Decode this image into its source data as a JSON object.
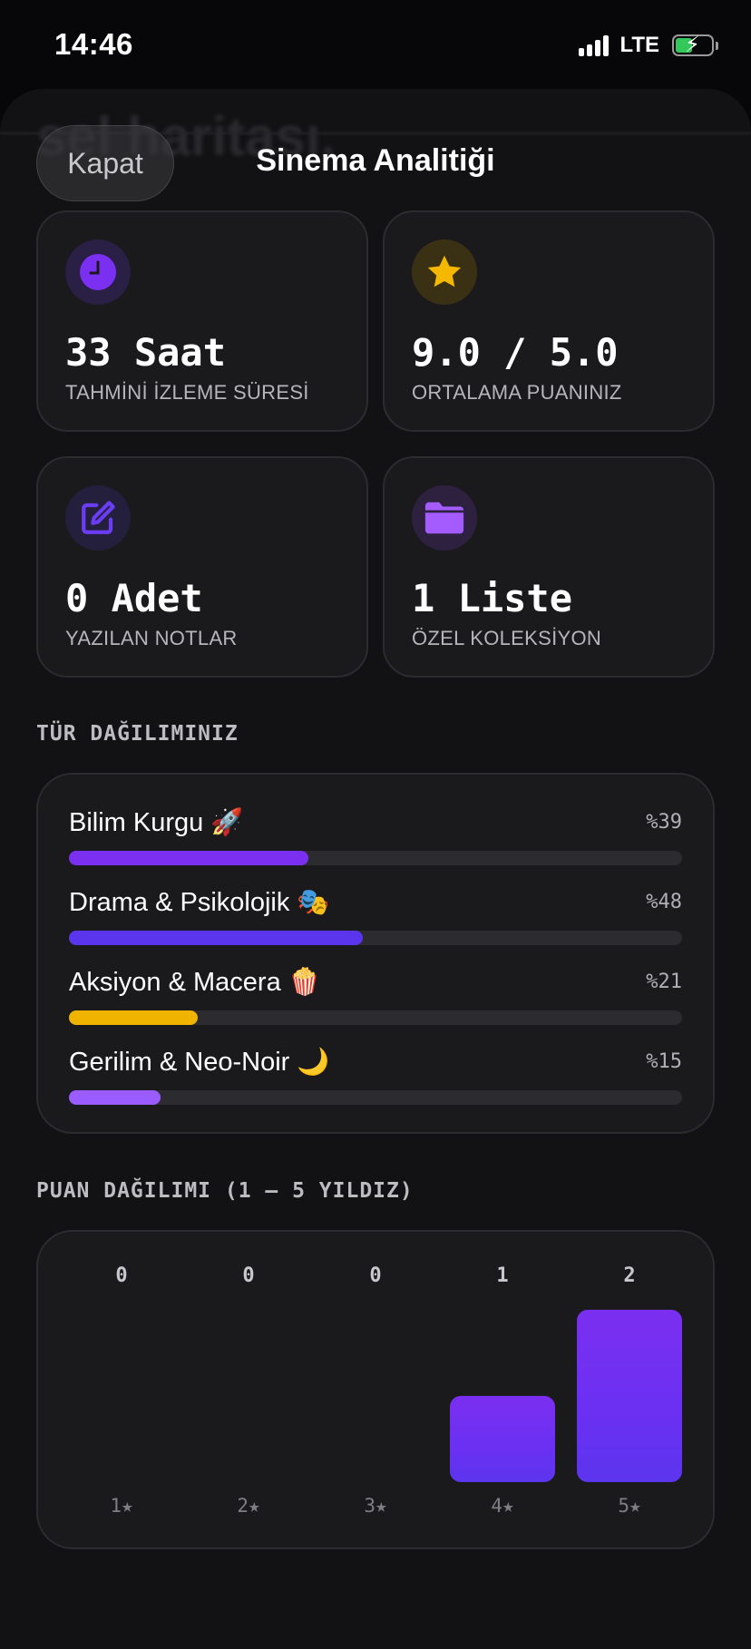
{
  "status_bar": {
    "time": "14:46",
    "network": "LTE"
  },
  "background_title": "sel haritası.",
  "header": {
    "close_label": "Kapat",
    "title": "Sinema Analitiği"
  },
  "stats": [
    {
      "value": "33 Saat",
      "label": "TAHMİNİ İZLEME SÜRESİ",
      "icon": "clock-icon",
      "color": "#7b2ff0"
    },
    {
      "value": "9.0 / 5.0",
      "label": "ORTALAMA PUANINIZ",
      "icon": "star-icon",
      "color": "#f5b800"
    },
    {
      "value": "0 Adet",
      "label": "YAZILAN NOTLAR",
      "icon": "edit-icon",
      "color": "#6a3df2"
    },
    {
      "value": "1 Liste",
      "label": "ÖZEL KOLEKSİYON",
      "icon": "folder-icon",
      "color": "#a45cff"
    }
  ],
  "genres": {
    "title": "TÜR DAĞILIMINIZ",
    "items": [
      {
        "name": "Bilim Kurgu 🚀",
        "percent_label": "%39",
        "value": 39,
        "color": "#7b2ff0"
      },
      {
        "name": "Drama & Psikolojik 🎭",
        "percent_label": "%48",
        "value": 48,
        "color": "#5b35ee"
      },
      {
        "name": "Aksiyon & Macera 🍿",
        "percent_label": "%21",
        "value": 21,
        "color": "#f0b400"
      },
      {
        "name": "Gerilim & Neo-Noir 🌙",
        "percent_label": "%15",
        "value": 15,
        "color": "#9b5cff"
      }
    ]
  },
  "ratings": {
    "title": "PUAN DAĞILIMI (1 – 5 YILDIZ)"
  },
  "chart_data": {
    "type": "bar",
    "categories": [
      "1★",
      "2★",
      "3★",
      "4★",
      "5★"
    ],
    "values": [
      0,
      0,
      0,
      1,
      2
    ],
    "ylim": [
      0,
      2
    ]
  }
}
